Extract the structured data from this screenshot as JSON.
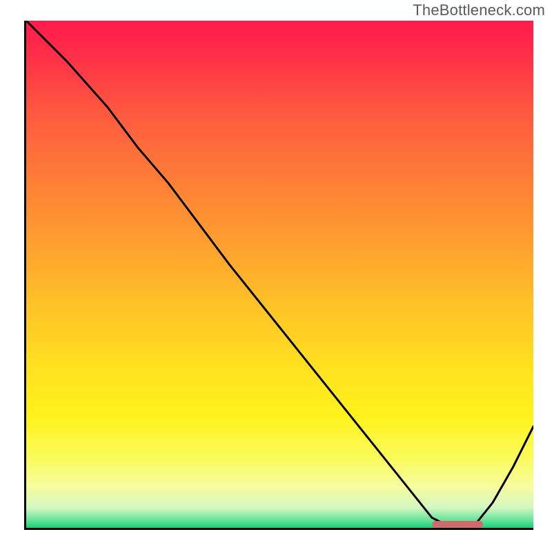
{
  "watermark": "TheBottleneck.com",
  "chart_data": {
    "type": "line",
    "title": "",
    "xlabel": "",
    "ylabel": "",
    "xlim": [
      0,
      100
    ],
    "ylim": [
      0,
      100
    ],
    "grid": false,
    "series": [
      {
        "name": "curve",
        "x": [
          0,
          8,
          16,
          22,
          28,
          40,
          52,
          64,
          76,
          80,
          84,
          88,
          92,
          96,
          100
        ],
        "y": [
          100,
          92,
          83,
          75,
          68,
          52,
          37,
          22,
          7,
          2,
          0,
          0,
          5,
          12,
          20
        ]
      }
    ],
    "annotations": [
      {
        "name": "min-plateau-marker",
        "x_start": 80,
        "x_end": 90,
        "y": 0.7
      }
    ],
    "gradient_stops": [
      {
        "pos": 0,
        "color": "#ff1a4b"
      },
      {
        "pos": 0.5,
        "color": "#ffd024"
      },
      {
        "pos": 0.85,
        "color": "#fbfb59"
      },
      {
        "pos": 1.0,
        "color": "#17cf73"
      }
    ]
  },
  "colors": {
    "curve": "#000000",
    "axis": "#000000",
    "marker": "#d06a6a",
    "watermark": "#5a5a5a"
  }
}
